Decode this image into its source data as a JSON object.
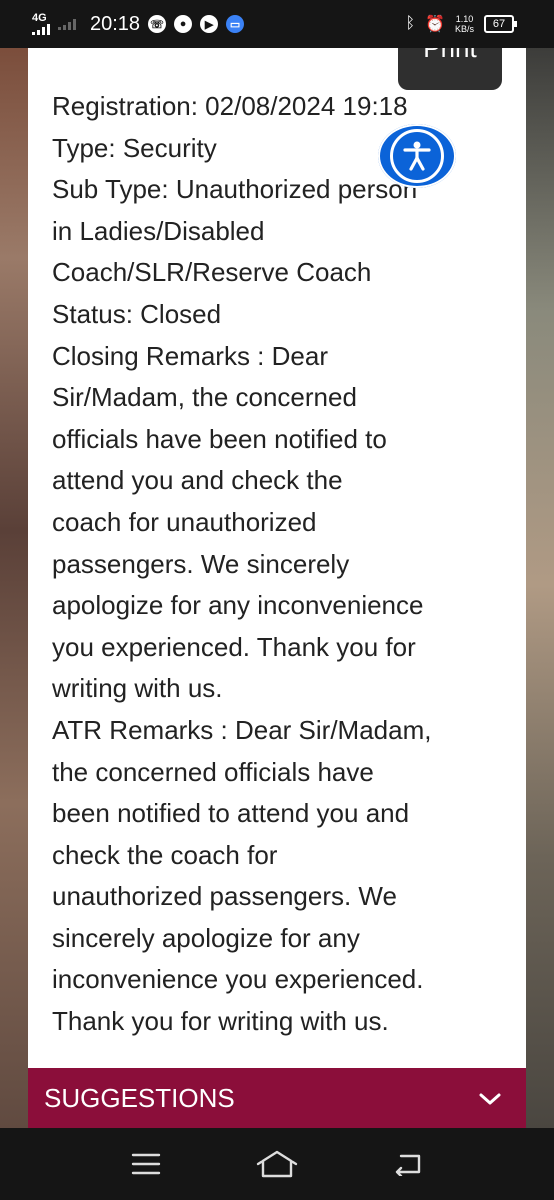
{
  "status_bar": {
    "network": "4G",
    "time": "20:18",
    "speed_value": "1.10",
    "speed_unit": "KB/s",
    "battery": "67"
  },
  "card": {
    "print_label": "Print",
    "lines": [
      "Registration: 02/08/2024 19:18",
      "Type: Security",
      "Sub Type: Unauthorized person",
      "in Ladies/Disabled",
      "Coach/SLR/Reserve Coach",
      "Status: Closed",
      "Closing Remarks : Dear",
      "Sir/Madam, the concerned",
      "officials have been notified to",
      "attend you and check the",
      "coach for unauthorized",
      "passengers. We sincerely",
      "apologize for any inconvenience",
      "you experienced. Thank you for",
      "writing with us.",
      "ATR Remarks : Dear Sir/Madam,",
      "the concerned officials have",
      "been notified to attend you and",
      "check the coach for",
      "unauthorized passengers. We",
      "sincerely apologize for any",
      "inconvenience you experienced.",
      "Thank you for writing with us."
    ]
  },
  "suggestions": {
    "label": "SUGGESTIONS",
    "icon": "chevron-down-icon"
  },
  "accessibility": {
    "icon": "accessibility-icon",
    "color": "#0b63d8"
  },
  "colors": {
    "suggestions_bg": "#8b0e3a",
    "print_bg": "#2f2f2f"
  }
}
